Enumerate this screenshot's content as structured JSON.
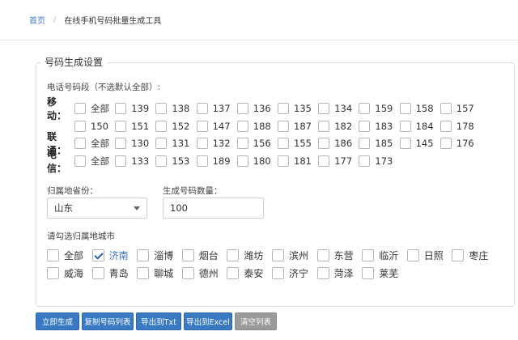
{
  "breadcrumb": {
    "home": "首页",
    "separator": "/",
    "current": "在线手机号码批量生成工具"
  },
  "settings": {
    "legend": "号码生成设置",
    "segment_hint": "电话号码段（不选默认全部）:",
    "all_label": "全部",
    "mobile": {
      "label": "移动：",
      "row1": [
        "139",
        "138",
        "137",
        "136",
        "135",
        "134",
        "159",
        "158",
        "157"
      ],
      "row2": [
        "150",
        "151",
        "152",
        "147",
        "188",
        "187",
        "182",
        "183",
        "184",
        "178"
      ]
    },
    "unicom": {
      "label": "联通：",
      "items": [
        "130",
        "131",
        "132",
        "156",
        "155",
        "186",
        "185",
        "145",
        "176"
      ]
    },
    "telecom": {
      "label": "电信：",
      "items": [
        "133",
        "153",
        "189",
        "180",
        "181",
        "177",
        "173"
      ]
    },
    "province_label": "归属地省份：",
    "province_value": "山东",
    "count_label": "生成号码数量：",
    "count_value": "100",
    "city_hint": "请勾选归属地城市",
    "cities_row1": [
      "全部",
      "济南",
      "淄博",
      "烟台",
      "潍坊",
      "滨州",
      "东营",
      "临沂",
      "日照",
      "枣庄"
    ],
    "cities_row2": [
      "威海",
      "青岛",
      "聊城",
      "德州",
      "泰安",
      "济宁",
      "菏泽",
      "莱芜"
    ],
    "checked_city": "济南"
  },
  "buttons": {
    "generate": "立即生成",
    "copy": "复制号码列表",
    "export_txt": "导出到Txt",
    "export_excel": "导出到Excel",
    "clear": "清空列表"
  },
  "colors": {
    "primary": "#3a7ac2",
    "link": "#3a79c1",
    "disabled": "#999999"
  }
}
